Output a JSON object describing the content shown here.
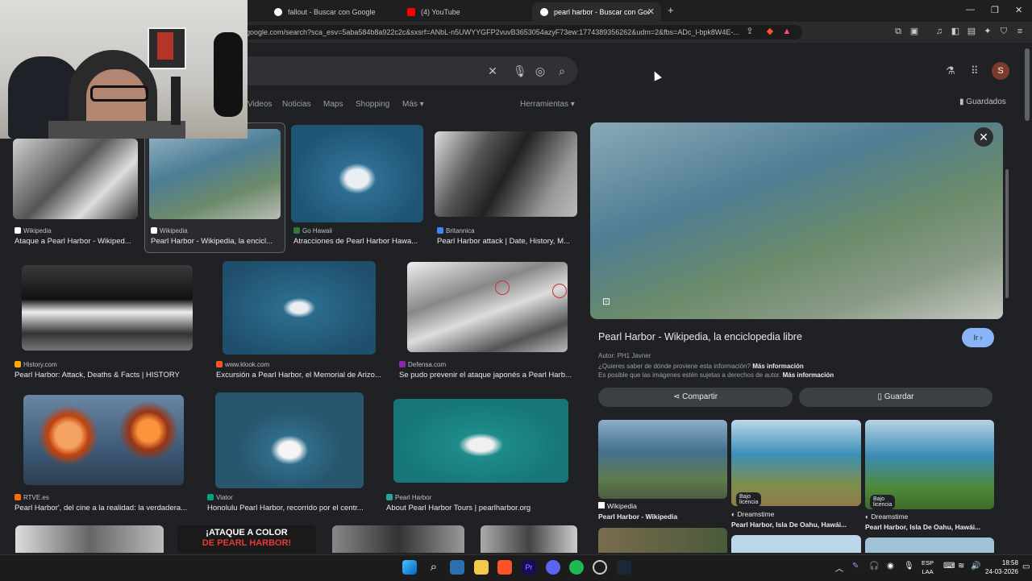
{
  "browser": {
    "tabs": [
      {
        "title": "fallout - Buscar con Google",
        "color": "#ffffff",
        "active": false
      },
      {
        "title": "(4) YouTube",
        "color": "#ff0000",
        "active": false
      },
      {
        "title": "pearl harbor - Buscar con Google",
        "color": "#ffffff",
        "active": true
      }
    ],
    "new_tab": "+",
    "url": "google.com/search?sca_esv=5aba584b8a922c2c&sxsrf=ANbL-n5UWYYGFP2vuvB3653054azyF73ew:1774389356262&udm=2&fbs=ADc_l-bpk8W4E-...",
    "window_controls": {
      "minimize": "—",
      "restore": "❐",
      "close": "✕"
    }
  },
  "google": {
    "search_value": "",
    "clear": "✕",
    "nav": {
      "videos": "Videos",
      "noticias": "Noticias",
      "maps": "Maps",
      "shopping": "Shopping",
      "mas": "Más",
      "herramientas": "Herramientas"
    },
    "guardados": "Guardados",
    "avatar_letter": "S"
  },
  "results": [
    {
      "source": "Wikipedia",
      "title": "Ataque a Pearl Harbor - Wikiped...",
      "icon_color": "#ffffff",
      "tone": "bw"
    },
    {
      "source": "Wikipedia",
      "title": "Pearl Harbor - Wikipedia, la encicl...",
      "icon_color": "#ffffff",
      "tone": "harbor"
    },
    {
      "source": "Go Hawaii",
      "title": "Atracciones de Pearl Harbor Hawa...",
      "icon_color": "#2e7d32",
      "tone": "blue"
    },
    {
      "source": "Britannica",
      "title": "Pearl Harbor attack | Date, History, M...",
      "icon_color": "#4285f4",
      "tone": "bw"
    },
    {
      "source": "History.com",
      "title": "Pearl Harbor: Attack, Deaths & Facts | HISTORY",
      "icon_color": "#f9ab00",
      "tone": "bw"
    },
    {
      "source": "www.klook.com",
      "title": "Excursión a Pearl Harbor, el Memorial de Arizo...",
      "icon_color": "#ff5722",
      "tone": "blue"
    },
    {
      "source": "Defensa.com",
      "title": "Se pudo prevenir el ataque japonés a Pearl Harb...",
      "icon_color": "#8e24aa",
      "tone": "bw"
    },
    {
      "source": "RTVE.es",
      "title": "Pearl Harbor', del cine a la realidad: la verdadera...",
      "icon_color": "#ff6d00",
      "tone": "fire"
    },
    {
      "source": "Viator",
      "title": "Honolulu Pearl Harbor, recorrido por el centr...",
      "icon_color": "#00a680",
      "tone": "green"
    },
    {
      "source": "Pearl Harbor",
      "title": "About Pearl Harbor Tours | pearlharbor.org",
      "icon_color": "#26a69a",
      "tone": "teal"
    }
  ],
  "bottom_row_banner": "¡ATAQUE A COLOR",
  "bottom_row_banner2": "DE PEARL HARBOR!",
  "panel": {
    "close": "✕",
    "title": "Pearl Harbor - Wikipedia, la enciclopedia libre",
    "ir": "Ir",
    "author": "Autor: PH1 Javner",
    "question": "¿Quieres saber de dónde proviene esta información?",
    "more_info": "Más información",
    "rights": "Es posible que las imágenes estén sujetas a derechos de autor.",
    "more_info2": "Más información",
    "share": "Compartir",
    "save": "Guardar",
    "related": [
      {
        "source": "Wikipedia",
        "title": "Pearl Harbor - Wikipedia",
        "badge": ""
      },
      {
        "source": "Dreamstime",
        "title": "Pearl Harbor, Isla De Oahu, Hawái...",
        "badge": "Bajo licencia"
      },
      {
        "source": "Dreamstime",
        "title": "Pearl Harbor, Isla De Oahu, Hawái...",
        "badge": "Bajo licencia"
      }
    ]
  },
  "taskbar": {
    "lang": "ESP",
    "lang2": "LAA",
    "time": "18:58",
    "date": "24-03-2026"
  }
}
